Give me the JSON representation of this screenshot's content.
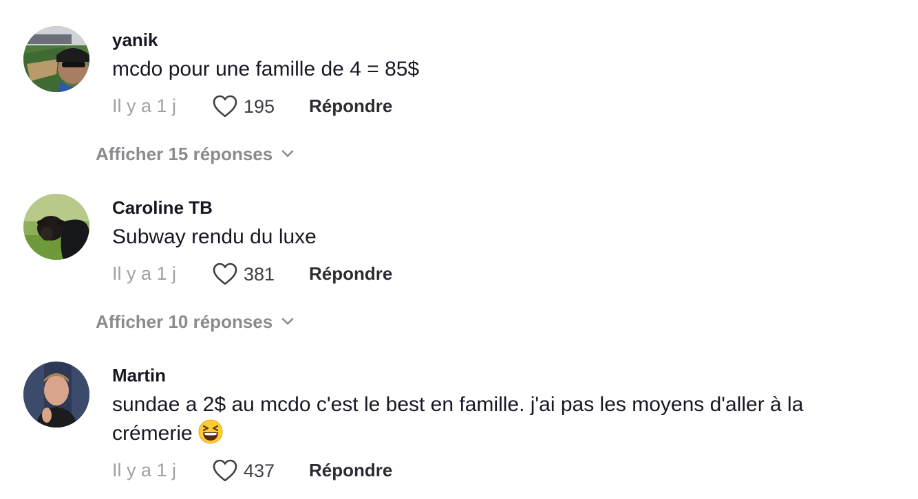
{
  "comments": [
    {
      "username": "yanik",
      "text": "mcdo pour une famille de 4 = 85$",
      "time": "Il y a 1 j",
      "likes": "195",
      "reply_label": "Répondre",
      "avatar_icon": "avatar-yanik",
      "show_replies": "Afficher 15 réponses"
    },
    {
      "username": "Caroline TB",
      "text": "Subway rendu du luxe",
      "time": "Il y a 1 j",
      "likes": "381",
      "reply_label": "Répondre",
      "avatar_icon": "avatar-caroline",
      "show_replies": "Afficher 10 réponses"
    },
    {
      "username": "Martin",
      "text_line1": "sundae a 2$ au mcdo c'est le best en famille. j'ai pas les moyens d'aller à la",
      "text_line2": "crémerie",
      "emoji": "grinning-squinting-face-emoji",
      "time": "Il y a 1 j",
      "likes": "437",
      "reply_label": "Répondre",
      "avatar_icon": "avatar-martin"
    }
  ],
  "colors": {
    "primary_text": "#161823",
    "secondary_text": "#a0a0a5",
    "show_replies_text": "#8a8b91",
    "background": "#ffffff"
  },
  "icons": {
    "like": "heart-outline-icon",
    "expand": "chevron-down-icon"
  }
}
